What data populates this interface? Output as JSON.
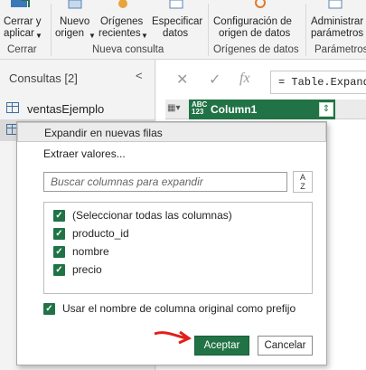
{
  "ribbon": {
    "close_apply": {
      "label": "Cerrar y\naplicar",
      "line1": "Cerrar y",
      "line2": "aplicar"
    },
    "new_source": {
      "line1": "Nuevo",
      "line2": "origen"
    },
    "recent_sources": {
      "line1": "Orígenes",
      "line2": "recientes"
    },
    "enter_data": {
      "line1": "Especificar",
      "line2": "datos"
    },
    "source_settings": {
      "line1": "Configuración de",
      "line2": "origen de datos"
    },
    "manage_params": {
      "line1": "Administrar",
      "line2": "parámetros"
    },
    "groups": {
      "close": "Cerrar",
      "new_query": "Nueva consulta",
      "data_sources": "Orígenes de datos",
      "parameters": "Parámetros"
    }
  },
  "queries": {
    "title": "Consultas [2]",
    "collapse": "<",
    "items": [
      {
        "label": "ventasEjemplo"
      },
      {
        "label": ""
      }
    ]
  },
  "formula_bar": {
    "cancel": "✕",
    "confirm": "✓",
    "fx": "fx",
    "formula": "= Table.ExpandLi"
  },
  "grid": {
    "column1": {
      "type_line1": "ABC",
      "type_line2": "123",
      "name": "Column1",
      "expand_icon": "expand-icon"
    }
  },
  "popup": {
    "options": [
      "Expandir en nuevas filas",
      "Extraer valores..."
    ],
    "search_placeholder": "Buscar columnas para expandir",
    "sort_top": "A",
    "sort_bottom": "Z",
    "columns": [
      {
        "label": "(Seleccionar todas las columnas)",
        "checked": true
      },
      {
        "label": "producto_id",
        "checked": true
      },
      {
        "label": "nombre",
        "checked": true
      },
      {
        "label": "precio",
        "checked": true
      }
    ],
    "use_prefix": {
      "label": "Usar el nombre de columna original como prefijo",
      "checked": true
    },
    "ok_label": "Aceptar",
    "cancel_label": "Cancelar"
  },
  "colors": {
    "accent": "#217346",
    "arrow": "#e0201b"
  }
}
